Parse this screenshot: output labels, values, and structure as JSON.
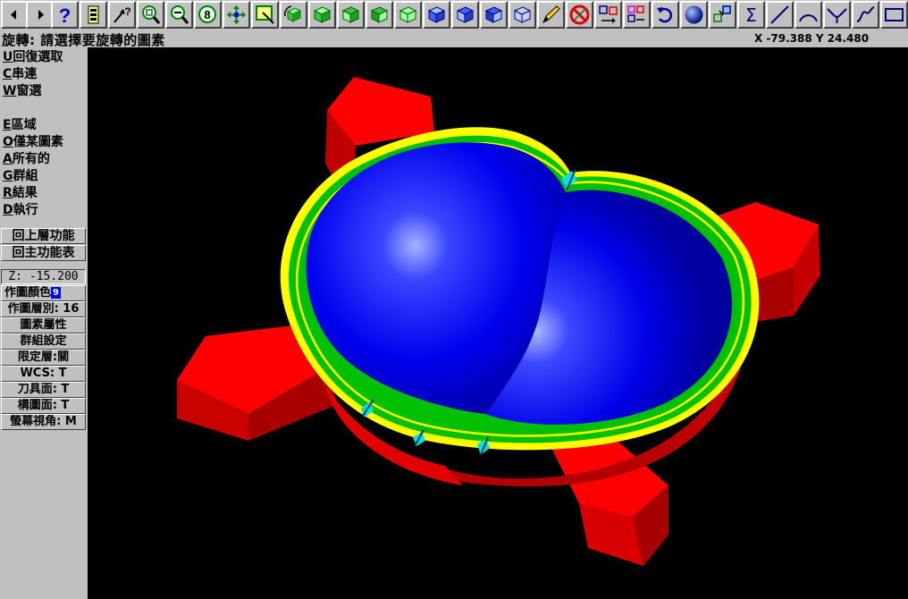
{
  "toolbar": {
    "buttons": [
      {
        "name": "prev-page-button",
        "icon": "arrow-left-icon"
      },
      {
        "name": "next-page-button",
        "icon": "arrow-right-icon"
      },
      {
        "name": "help-button",
        "icon": "question-icon"
      },
      {
        "name": "memory-button",
        "icon": "battery-icon"
      },
      {
        "name": "analyze-button",
        "icon": "pointer-question-icon"
      },
      {
        "name": "zoom-window-button",
        "icon": "zoom-window-icon"
      },
      {
        "name": "zoom-out-button",
        "icon": "zoom-out-icon"
      },
      {
        "name": "zoom-8-button",
        "icon": "zoom-8-icon"
      },
      {
        "name": "pan-button",
        "icon": "move-arrows-icon"
      },
      {
        "name": "select-window-button",
        "icon": "select-box-icon"
      },
      {
        "name": "rotate-view-button",
        "icon": "rotate-cube-icon"
      },
      {
        "name": "view-top-button",
        "icon": "cube-green-icon"
      },
      {
        "name": "view-front-button",
        "icon": "cube-green-icon"
      },
      {
        "name": "view-side-button",
        "icon": "cube-green-icon"
      },
      {
        "name": "view-iso-button",
        "icon": "cube-green-icon"
      },
      {
        "name": "cplane-top-button",
        "icon": "cube-blue-icon"
      },
      {
        "name": "cplane-front-button",
        "icon": "cube-blue-icon"
      },
      {
        "name": "cplane-side-button",
        "icon": "cube-blue-icon"
      },
      {
        "name": "cplane-3d-button",
        "icon": "cube-blue-icon"
      },
      {
        "name": "clear-color-button",
        "icon": "pencil-icon"
      },
      {
        "name": "delete-button",
        "icon": "no-entry-icon"
      },
      {
        "name": "translate-button",
        "icon": "translate-icon"
      },
      {
        "name": "copy-button",
        "icon": "copy-boxes-icon"
      },
      {
        "name": "undo-button",
        "icon": "undo-arrow-icon"
      },
      {
        "name": "shading-button",
        "icon": "sphere-icon"
      },
      {
        "name": "group-button",
        "icon": "group-boxes-icon"
      },
      {
        "name": "sum-button",
        "icon": "sigma-icon"
      },
      {
        "name": "line-button",
        "icon": "line-icon"
      },
      {
        "name": "arc-button",
        "icon": "arc-icon"
      },
      {
        "name": "fillet-button",
        "icon": "fillet-icon"
      },
      {
        "name": "spline-button",
        "icon": "spline-icon"
      },
      {
        "name": "rectangle-button",
        "icon": "rectangle-icon"
      }
    ]
  },
  "status": {
    "prompt": "旋轉: 請選擇要旋轉的圖素",
    "coords": "X -79.388  Y 24.480"
  },
  "menu": {
    "items": [
      {
        "key": "U",
        "label": "回復選取"
      },
      {
        "key": "C",
        "label": "串連"
      },
      {
        "key": "W",
        "label": "窗選"
      },
      {
        "key": "E",
        "label": "區域"
      },
      {
        "key": "O",
        "label": "僅某圖素"
      },
      {
        "key": "A",
        "label": "所有的"
      },
      {
        "key": "G",
        "label": "群組"
      },
      {
        "key": "R",
        "label": "結果"
      },
      {
        "key": "D",
        "label": "執行"
      }
    ],
    "back_level": "回上層功能",
    "main_menu": "回主功能表"
  },
  "panel": {
    "z_value": "Z: -15.200",
    "color_label": "作圖顏色",
    "color_value": "9",
    "level_label": "作圖層別: 16",
    "attributes": "圖素屬性",
    "group_setup": "群組設定",
    "mask": "限定層:關",
    "wcs": "WCS:  T",
    "tool_plane": "刀具面: T",
    "construction_plane": "構圖面: T",
    "screen_view": "螢幕視角: M"
  },
  "colors": {
    "viewport_bg": "#000000",
    "bowl_blue": "#0000ff",
    "flange_red": "#ff0000",
    "rim_yellow": "#ffff00",
    "rim_green": "#00c000",
    "marker_cyan": "#00e0e0"
  }
}
